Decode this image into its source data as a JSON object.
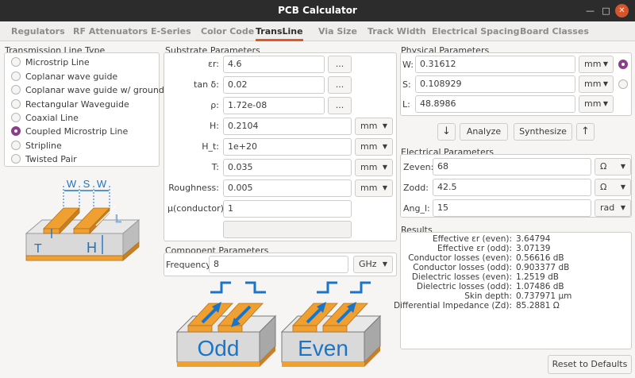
{
  "window": {
    "title": "PCB Calculator"
  },
  "tabs": [
    {
      "label": "Regulators"
    },
    {
      "label": "RF Attenuators"
    },
    {
      "label": "E-Series"
    },
    {
      "label": "Color Code"
    },
    {
      "label": "TransLine"
    },
    {
      "label": "Via Size"
    },
    {
      "label": "Track Width"
    },
    {
      "label": "Electrical Spacing"
    },
    {
      "label": "Board Classes"
    }
  ],
  "line_type": {
    "title": "Transmission Line Type",
    "options": [
      {
        "label": "Microstrip Line"
      },
      {
        "label": "Coplanar wave guide"
      },
      {
        "label": "Coplanar wave guide w/ ground plane"
      },
      {
        "label": "Rectangular Waveguide"
      },
      {
        "label": "Coaxial Line"
      },
      {
        "label": "Coupled Microstrip Line"
      },
      {
        "label": "Stripline"
      },
      {
        "label": "Twisted Pair"
      }
    ],
    "selected": "Coupled Microstrip Line"
  },
  "diagram": {
    "labels": {
      "w1": "W",
      "s": "S",
      "w2": "W",
      "l": "L",
      "t": "T",
      "h": "H"
    },
    "colors": {
      "copper": "#f0a030",
      "substrate": "#d9d9d9",
      "arrow": "#1a75c9"
    }
  },
  "substrate": {
    "title": "Substrate Parameters",
    "rows": [
      {
        "label": "εr:",
        "value": "4.6",
        "button": "..."
      },
      {
        "label": "tan δ:",
        "value": "0.02",
        "button": "..."
      },
      {
        "label": "ρ:",
        "value": "1.72e-08",
        "button": "..."
      },
      {
        "label": "H:",
        "value": "0.2104",
        "unit": "mm"
      },
      {
        "label": "H_t:",
        "value": "1e+20",
        "unit": "mm"
      },
      {
        "label": "T:",
        "value": "0.035",
        "unit": "mm"
      },
      {
        "label": "Roughness:",
        "value": "0.005",
        "unit": "mm"
      },
      {
        "label": "μ(conductor):",
        "value": "1"
      }
    ]
  },
  "component": {
    "title": "Component Parameters",
    "frequency_label": "Frequency:",
    "frequency_value": "8",
    "frequency_unit": "GHz"
  },
  "modes": {
    "odd_label": "Odd",
    "even_label": "Even"
  },
  "physical": {
    "title": "Physical Parameters",
    "rows": [
      {
        "label": "W:",
        "value": "0.31612",
        "unit": "mm"
      },
      {
        "label": "S:",
        "value": "0.108929",
        "unit": "mm"
      },
      {
        "label": "L:",
        "value": "48.8986",
        "unit": "mm"
      }
    ],
    "analyze_label": "Analyze",
    "synthesize_label": "Synthesize",
    "down_arrow": "↓",
    "up_arrow": "↑"
  },
  "electrical": {
    "title": "Electrical Parameters",
    "rows": [
      {
        "label": "Zeven:",
        "value": "68",
        "unit": "Ω"
      },
      {
        "label": "Zodd:",
        "value": "42.5",
        "unit": "Ω"
      },
      {
        "label": "Ang_l:",
        "value": "15",
        "unit": "rad"
      }
    ]
  },
  "results": {
    "title": "Results",
    "rows": [
      {
        "label": "Effective εr (even):",
        "value": "3.64794"
      },
      {
        "label": "Effective εr (odd):",
        "value": "3.07139"
      },
      {
        "label": "Conductor losses (even):",
        "value": "0.56616 dB"
      },
      {
        "label": "Conductor losses (odd):",
        "value": "0.903377 dB"
      },
      {
        "label": "Dielectric losses (even):",
        "value": "1.2519 dB"
      },
      {
        "label": "Dielectric losses (odd):",
        "value": "1.07486 dB"
      },
      {
        "label": "Skin depth:",
        "value": "0.737971 μm"
      },
      {
        "label": "Differential Impedance (Zd):",
        "value": "85.2881 Ω"
      }
    ]
  },
  "reset_label": "Reset to Defaults",
  "dropdown_arrow": "▼",
  "accent_color": "#e95420"
}
